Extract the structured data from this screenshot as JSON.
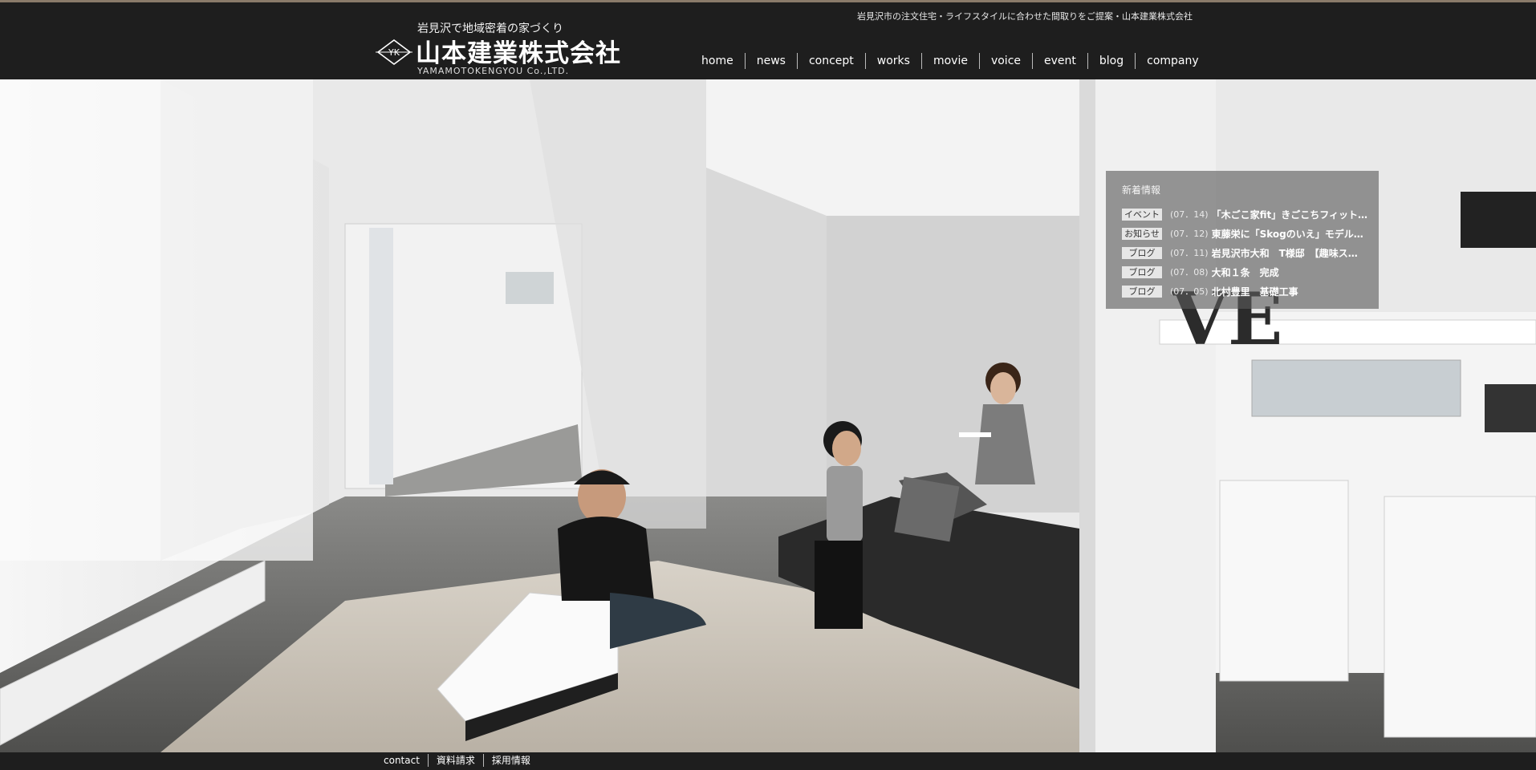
{
  "header": {
    "tagline": "岩見沢市の注文住宅・ライフスタイルに合わせた間取りをご提案・山本建業株式会社",
    "logo": {
      "mark": "YK",
      "sub": "岩見沢で地域密着の家づくり",
      "main": "山本建業株式会社",
      "en": "YAMAMOTOKENGYOU Co.,LTD."
    }
  },
  "nav": {
    "items": [
      {
        "label": "home"
      },
      {
        "label": "news"
      },
      {
        "label": "concept"
      },
      {
        "label": "works"
      },
      {
        "label": "movie"
      },
      {
        "label": "voice"
      },
      {
        "label": "event"
      },
      {
        "label": "blog"
      },
      {
        "label": "company"
      }
    ]
  },
  "news": {
    "heading": "新着情報",
    "items": [
      {
        "badge": "イベント",
        "date": "(07．14)",
        "title": "「木ごこ家fit」きごこちフィット…"
      },
      {
        "badge": "お知らせ",
        "date": "(07．12)",
        "title": "東藤栄に「Skogのいえ」モデル…"
      },
      {
        "badge": "ブログ",
        "date": "(07．11)",
        "title": "岩見沢市大和　T様邸　【趣味ス…"
      },
      {
        "badge": "ブログ",
        "date": "(07．08)",
        "title": "大和１条　完成"
      },
      {
        "badge": "ブログ",
        "date": "(07．05)",
        "title": "北村豊里　基礎工事"
      }
    ]
  },
  "footer": {
    "links": [
      {
        "label": "contact"
      },
      {
        "label": "資料請求"
      },
      {
        "label": "採用情報"
      }
    ]
  },
  "hero": {
    "decor_text": "VE"
  },
  "colors": {
    "background": "#1e1e1e",
    "accent": "#8a7b6a",
    "panel": "#5a5a5a"
  }
}
